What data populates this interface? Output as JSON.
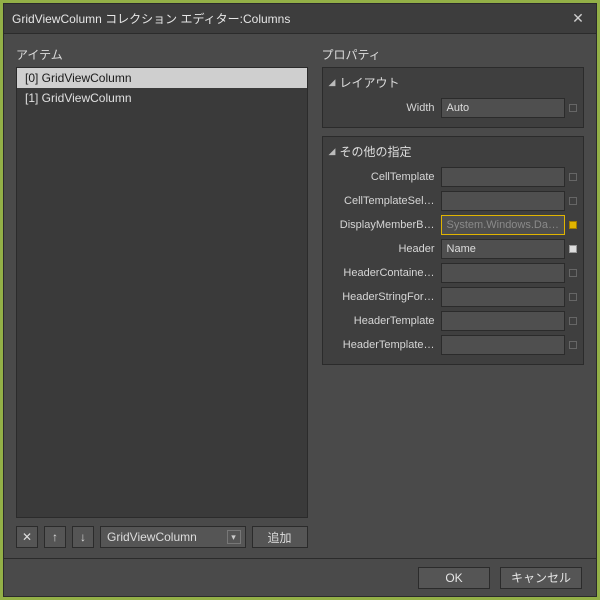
{
  "title": "GridViewColumn  コレクション エディター:Columns",
  "left": {
    "label": "アイテム",
    "items": [
      {
        "label": "[0] GridViewColumn",
        "selected": true
      },
      {
        "label": "[1] GridViewColumn",
        "selected": false
      }
    ],
    "type_combo": "GridViewColumn",
    "remove_glyph": "✕",
    "up_glyph": "↑",
    "down_glyph": "↓",
    "add_label": "追加"
  },
  "right": {
    "label": "プロパティ",
    "cat_layout": "レイアウト",
    "cat_other": "その他の指定",
    "rows": {
      "width": {
        "name": "Width",
        "value": "Auto",
        "marker": "empty"
      },
      "cellTemplate": {
        "name": "CellTemplate",
        "value": "",
        "marker": "empty"
      },
      "cellTemplateSel": {
        "name": "CellTemplateSel…",
        "value": "",
        "marker": "empty"
      },
      "displayMember": {
        "name": "DisplayMemberB…",
        "value": "System.Windows.Da…",
        "marker": "amber",
        "highlight": true,
        "placeholder": true
      },
      "header": {
        "name": "Header",
        "value": "Name",
        "marker": "filled"
      },
      "headerContainer": {
        "name": "HeaderContaine…",
        "value": "",
        "marker": "empty"
      },
      "headerStringFmt": {
        "name": "HeaderStringFor…",
        "value": "",
        "marker": "empty"
      },
      "headerTemplate": {
        "name": "HeaderTemplate",
        "value": "",
        "marker": "empty"
      },
      "headerTemplateSel": {
        "name": "HeaderTemplate…",
        "value": "",
        "marker": "empty"
      }
    }
  },
  "footer": {
    "ok": "OK",
    "cancel": "キャンセル"
  }
}
